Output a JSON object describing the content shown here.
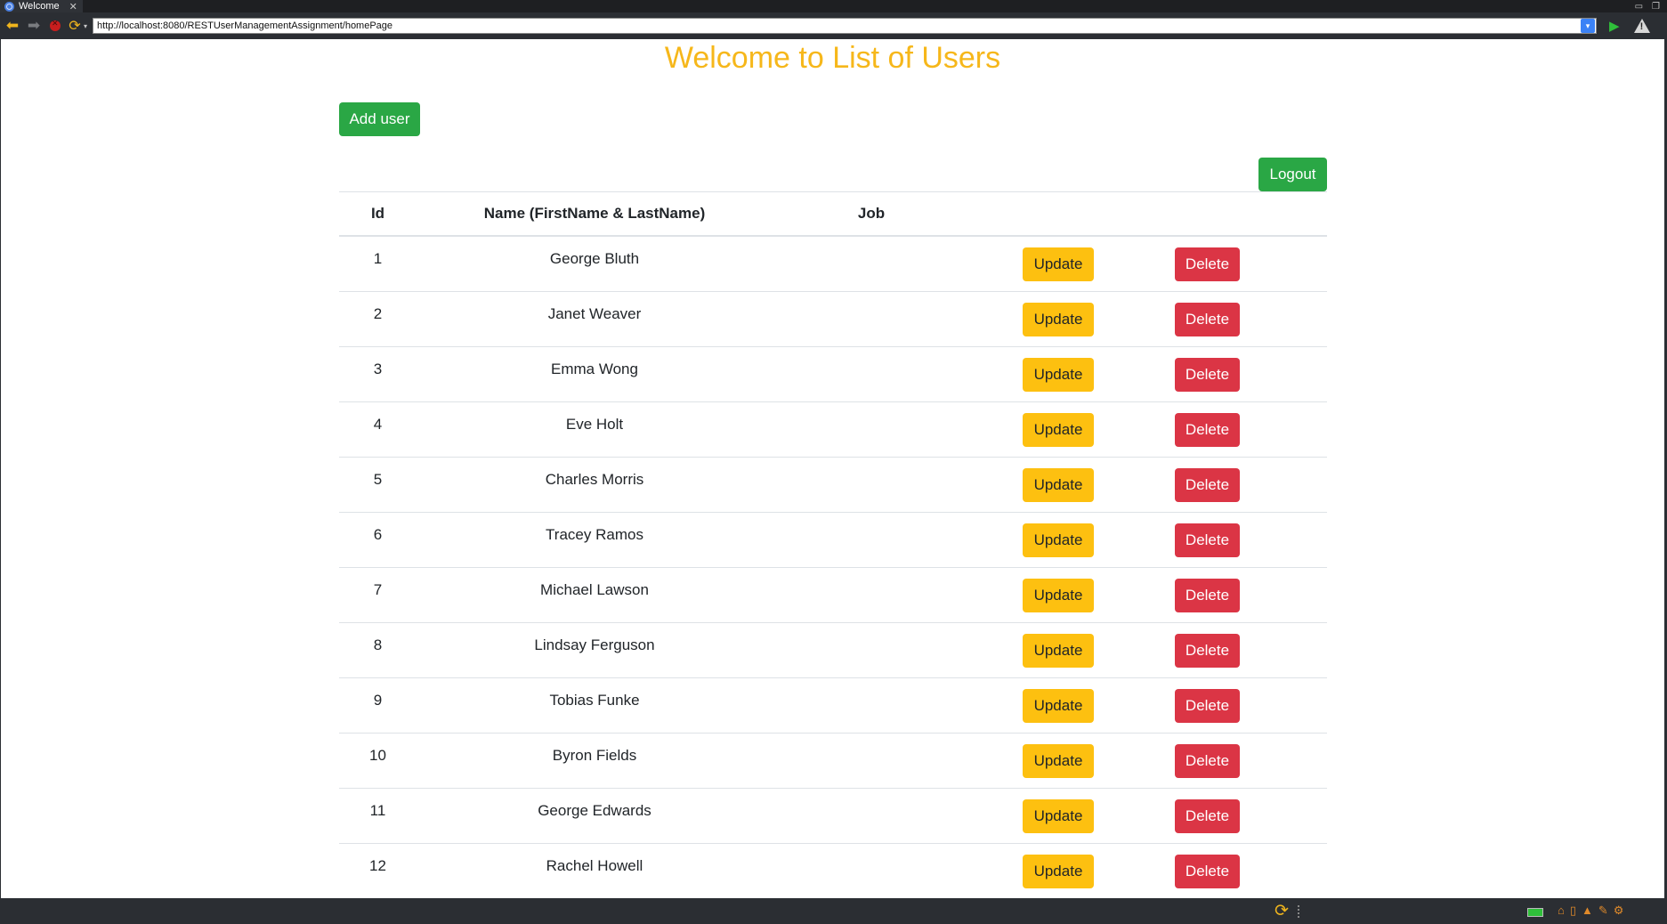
{
  "browser": {
    "tab_title": "Welcome",
    "url": "http://localhost:8080/RESTUserManagementAssignment/homePage"
  },
  "page": {
    "title": "Welcome to List of Users",
    "add_user_label": "Add user",
    "logout_label": "Logout"
  },
  "table": {
    "headers": {
      "id": "Id",
      "name": "Name (FirstName & LastName)",
      "job": "Job"
    },
    "update_label": "Update",
    "delete_label": "Delete",
    "rows": [
      {
        "id": "1",
        "name": "George Bluth",
        "job": ""
      },
      {
        "id": "2",
        "name": "Janet Weaver",
        "job": ""
      },
      {
        "id": "3",
        "name": "Emma Wong",
        "job": ""
      },
      {
        "id": "4",
        "name": "Eve Holt",
        "job": ""
      },
      {
        "id": "5",
        "name": "Charles Morris",
        "job": ""
      },
      {
        "id": "6",
        "name": "Tracey Ramos",
        "job": ""
      },
      {
        "id": "7",
        "name": "Michael Lawson",
        "job": ""
      },
      {
        "id": "8",
        "name": "Lindsay Ferguson",
        "job": ""
      },
      {
        "id": "9",
        "name": "Tobias Funke",
        "job": ""
      },
      {
        "id": "10",
        "name": "Byron Fields",
        "job": ""
      },
      {
        "id": "11",
        "name": "George Edwards",
        "job": ""
      },
      {
        "id": "12",
        "name": "Rachel Howell",
        "job": ""
      }
    ]
  },
  "colors": {
    "title": "#f6b71a",
    "primary_green": "#2aa745",
    "update_yellow": "#fdc010",
    "delete_red": "#db3545",
    "chrome_dark": "#2b2e33"
  },
  "icons": [
    "globe-icon",
    "tab-close-icon",
    "back-arrow-icon",
    "forward-arrow-icon",
    "stop-icon",
    "reload-icon",
    "url-dropdown-icon",
    "go-icon",
    "warning-icon",
    "sync-icon",
    "battery-icon",
    "home-icon",
    "book-icon",
    "graduation-cap-icon",
    "pen-icon",
    "gear-icon"
  ]
}
